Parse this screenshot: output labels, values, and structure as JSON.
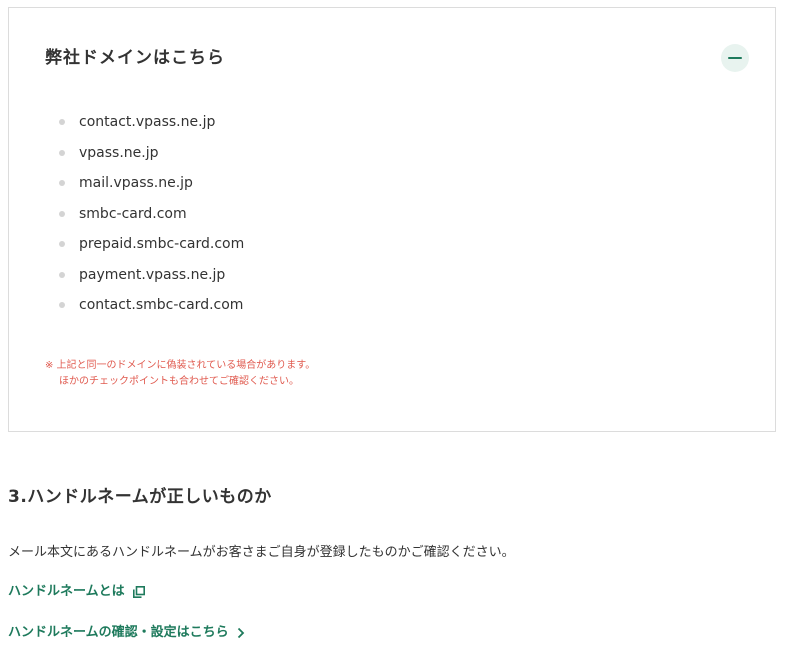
{
  "accordion": {
    "title": "弊社ドメインはこちら",
    "collapse_icon": "minus-icon",
    "domains": [
      "contact.vpass.ne.jp",
      "vpass.ne.jp",
      "mail.vpass.ne.jp",
      "smbc-card.com",
      "prepaid.smbc-card.com",
      "payment.vpass.ne.jp",
      "contact.smbc-card.com"
    ],
    "note_line1": "※ 上記と同一のドメインに偽装されている場合があります。",
    "note_line2": "ほかのチェックポイントも合わせてご確認ください。"
  },
  "section": {
    "heading": "3.ハンドルネームが正しいものか",
    "body": "メール本文にあるハンドルネームがお客さまご自身が登録したものかご確認ください。",
    "link1_label": "ハンドルネームとは",
    "link1_icon": "external-window-icon",
    "link2_label": "ハンドルネームの確認・設定はこちら",
    "link2_icon": "chevron-right-icon"
  },
  "colors": {
    "accent_green": "#1e7a5c",
    "note_red": "#e05a4f",
    "button_bg": "#e8f3ef",
    "border": "#dcdcdc"
  }
}
